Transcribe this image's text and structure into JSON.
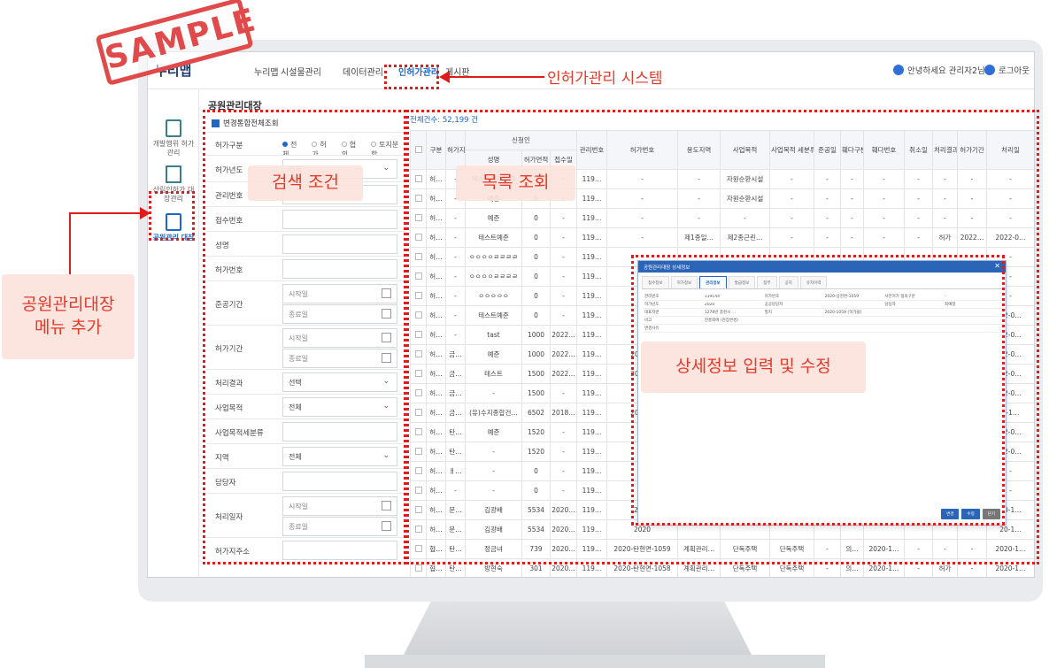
{
  "stamp_text": "SAMPLE",
  "app": {
    "logo": "누리맵",
    "nav": [
      "누리맵",
      "시설물관리",
      "데이터관리",
      "인허가관리",
      "게시판"
    ],
    "active_nav": "인허가관리",
    "greeting": "안녕하세요 관리자2님",
    "logout": "로그아웃"
  },
  "sidenav": {
    "items": [
      {
        "label": "개발행위 허가관리"
      },
      {
        "label": "산림인허가 대장관리"
      },
      {
        "label": "공원관리 대장"
      }
    ]
  },
  "page_title": "공원관리대장",
  "search": {
    "all_label": "변경통합전체조회",
    "fields": {
      "permit_type": {
        "label": "허가구분",
        "options": [
          "전체",
          "허가",
          "협의",
          "토지분할"
        ],
        "selected": "전체"
      },
      "permit_year": {
        "label": "허가년도",
        "value": "전체"
      },
      "mgmt_no": {
        "label": "관리번호",
        "value": ""
      },
      "receipt_no": {
        "label": "접수번호",
        "value": ""
      },
      "name": {
        "label": "성명",
        "value": ""
      },
      "permit_no": {
        "label": "허가번호",
        "value": ""
      },
      "completion_period": {
        "label": "준공기간",
        "start_placeholder": "시작일",
        "end_placeholder": "종료일"
      },
      "permit_period": {
        "label": "허가기간",
        "start_placeholder": "시작일",
        "end_placeholder": "종료일"
      },
      "process_result": {
        "label": "처리결과",
        "value": "선택"
      },
      "purpose": {
        "label": "사업목적",
        "value": "전체"
      },
      "purpose_detail": {
        "label": "사업목적세분류",
        "value": ""
      },
      "region": {
        "label": "지역",
        "value": "전체"
      },
      "manager": {
        "label": "담당자",
        "value": ""
      },
      "process_date": {
        "label": "처리일자",
        "start_placeholder": "시작일",
        "end_placeholder": "종료일"
      },
      "address": {
        "label": "허가지주소",
        "value": ""
      }
    }
  },
  "results": {
    "count_label": "전체건수: 52,199 건",
    "group_header": "신청인",
    "columns": [
      "구분",
      "허가지",
      "성명",
      "허가면적",
      "접수일",
      "관리번호",
      "허가번호",
      "용도지역",
      "사업목적",
      "사업목적 세분류",
      "준공일",
      "훼다구분",
      "훼다번호",
      "취소일",
      "처리결과",
      "허가기간",
      "처리일"
    ],
    "rows": [
      [
        "허…",
        "-",
        "테스트예준123",
        "0",
        "-",
        "119…",
        "-",
        "-",
        "자원순환시설",
        "-",
        "-",
        "-",
        "-",
        "-",
        "-",
        "-",
        "-"
      ],
      [
        "허…",
        "-",
        "예준",
        "0",
        "-",
        "119…",
        "-",
        "-",
        "자원순환시설",
        "-",
        "-",
        "-",
        "-",
        "-",
        "-",
        "-",
        "-"
      ],
      [
        "허…",
        "-",
        "예준",
        "0",
        "-",
        "119…",
        "-",
        "-",
        "-",
        "-",
        "-",
        "-",
        "-",
        "-",
        "-",
        "-",
        "-"
      ],
      [
        "허…",
        "-",
        "테스트예준",
        "0",
        "-",
        "119…",
        "-",
        "제1종일…",
        "제2종근린…",
        "-",
        "-",
        "-",
        "-",
        "-",
        "허가",
        "2022…",
        "2022-0…"
      ],
      [
        "허…",
        "-",
        "ㅇㅇㅇㅇㄹㄹㄹㄹ",
        "0",
        "-",
        "119…",
        "",
        "",
        "",
        "",
        "",
        "",
        "",
        "",
        "",
        "",
        "-"
      ],
      [
        "허…",
        "-",
        "ㅇㅇㅇㅇㄹㄹㄹㄹ",
        "0",
        "-",
        "119…",
        "",
        "",
        "",
        "",
        "",
        "",
        "",
        "",
        "",
        "",
        "-"
      ],
      [
        "허…",
        "-",
        "ㅇㅇㅇㅇㅇ",
        "0",
        "-",
        "119…",
        "",
        "",
        "",
        "",
        "",
        "",
        "",
        "",
        "",
        "",
        "-"
      ],
      [
        "허…",
        "-",
        "테스트예준",
        "0",
        "-",
        "119…",
        "",
        "",
        "",
        "",
        "",
        "",
        "",
        "",
        "",
        "",
        "22-0…"
      ],
      [
        "허…",
        "-",
        "tast",
        "1000",
        "2022…",
        "119…",
        "",
        "",
        "",
        "",
        "",
        "",
        "",
        "",
        "",
        "",
        "22-0…"
      ],
      [
        "허…",
        "금…",
        "예준",
        "1000",
        "2022…",
        "119…",
        "2022…",
        "",
        "",
        "",
        "",
        "",
        "",
        "",
        "",
        "",
        "22-0…"
      ],
      [
        "허…",
        "금…",
        "테스트",
        "1500",
        "2022…",
        "119…",
        "2013…",
        "",
        "",
        "",
        "",
        "",
        "",
        "",
        "",
        "",
        "22-0…"
      ],
      [
        "허…",
        "금…",
        "-",
        "1500",
        "-",
        "119…",
        "",
        "",
        "",
        "",
        "",
        "",
        "",
        "",
        "",
        "",
        "22-0…"
      ],
      [
        "허…",
        "금…",
        "(유)수지종합건…",
        "6502",
        "2018…",
        "119…",
        "2013…",
        "",
        "",
        "",
        "",
        "",
        "",
        "",
        "",
        "",
        "8-1…"
      ],
      [
        "허…",
        "탄…",
        "예준",
        "1520",
        "-",
        "119…",
        "",
        "",
        "",
        "",
        "",
        "",
        "",
        "",
        "",
        "",
        "22-0…"
      ],
      [
        "허…",
        "탄…",
        "-",
        "1520",
        "-",
        "119…",
        "",
        "",
        "",
        "",
        "",
        "",
        "",
        "",
        "",
        "",
        "22-0…"
      ],
      [
        "허…",
        "ㅐ…",
        "-",
        "0",
        "-",
        "119…",
        "12",
        "",
        "",
        "",
        "",
        "",
        "",
        "",
        "",
        "",
        "-"
      ],
      [
        "허…",
        "-",
        "-",
        "0",
        "-",
        "119…",
        "",
        "",
        "",
        "",
        "",
        "",
        "",
        "",
        "",
        "",
        "-"
      ],
      [
        "허…",
        "문…",
        "김광배",
        "5534",
        "2020…",
        "119…",
        "2020",
        "",
        "",
        "",
        "",
        "",
        "",
        "",
        "",
        "",
        "20-1…"
      ],
      [
        "허…",
        "문…",
        "김광배",
        "5534",
        "2020…",
        "119…",
        "2020",
        "",
        "",
        "",
        "",
        "",
        "",
        "",
        "",
        "",
        "20-1…"
      ],
      [
        "협…",
        "탄…",
        "정금녀",
        "739",
        "2020…",
        "119…",
        "2020-탄현면-1059",
        "계획관리…",
        "단독주택",
        "단독주택",
        "-",
        "의…",
        "2020-1…",
        "-",
        "-",
        "-",
        "2020-1…"
      ],
      [
        "협…",
        "탄…",
        "방현숙",
        "301",
        "2020…",
        "119…",
        "2020-탄현면-1058",
        "계획관리…",
        "단독주택",
        "단독주택",
        "-",
        "의…",
        "2020-1…",
        "-",
        "허가",
        "-",
        "2020-1…"
      ]
    ]
  },
  "modal": {
    "title": "공원관리대장 상세정보",
    "tabs": [
      "접수정보",
      "허가정보",
      "관리정보",
      "발급정보",
      "첨부",
      "공지",
      "유지이력"
    ],
    "active_tab": "관리정보",
    "fields": [
      [
        "관리번호",
        "119144",
        "허가번호",
        "2020-상현면-1059",
        "사전허가 협의구분",
        "-"
      ],
      [
        "허가년도",
        "2020",
        "공공담당자",
        "",
        "담당자",
        "최예정"
      ],
      [
        "대표지번",
        "1278번 종천시 ...",
        "필지",
        "2020-1059 [허가을]",
        "",
        ""
      ],
      [
        "비고",
        "진흥외에 (현장변경)",
        "",
        "",
        "",
        ""
      ],
      [
        "변경사유",
        "",
        "",
        "",
        "",
        ""
      ]
    ],
    "buttons": [
      "변경",
      "수정",
      "닫기"
    ]
  },
  "annotations": {
    "system": "인허가관리 시스템",
    "search": "검색 조건",
    "list": "목록 조회",
    "menu": "공원관리대장\n메뉴 추가",
    "detail": "상세정보 입력 및 수정"
  }
}
